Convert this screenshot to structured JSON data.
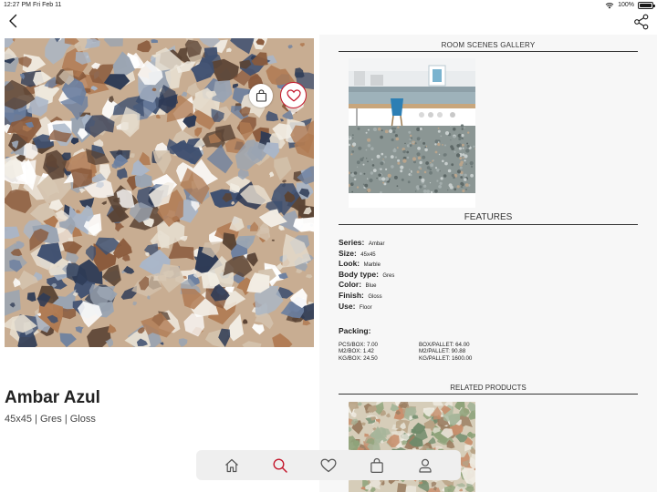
{
  "status_bar": {
    "time": "12:27 PM",
    "date": "Fri Feb 11",
    "battery_text": "100%",
    "battery_level": 1.0
  },
  "nav": {
    "back_icon": "chevron-left-icon",
    "share_icon": "share-icon"
  },
  "product": {
    "title": "Ambar Azul",
    "subtitle": "45x45 | Gres | Gloss",
    "bag_icon": "shopping-bag-icon",
    "heart_icon": "heart-icon",
    "accent_color": "#c4172c"
  },
  "room_scenes": {
    "heading": "ROOM SCENES GALLERY"
  },
  "features": {
    "heading": "FEATURES",
    "items": [
      {
        "label": "Series:",
        "value": "Ambar"
      },
      {
        "label": "Size:",
        "value": "45x45"
      },
      {
        "label": "Look:",
        "value": "Marble"
      },
      {
        "label": "Body type:",
        "value": "Gres"
      },
      {
        "label": "Color:",
        "value": "Blue"
      },
      {
        "label": "Finish:",
        "value": "Gloss"
      },
      {
        "label": "Use:",
        "value": "Floor"
      }
    ]
  },
  "packing": {
    "title": "Packing:",
    "left": [
      "PCS/BOX: 7.00",
      "M2/BOX: 1.42",
      "KG/BOX: 24.50"
    ],
    "right": [
      "BOX/PALLET: 64.00",
      "M2/PALLET: 90.88",
      "KG/PALLET: 1600.00"
    ]
  },
  "related": {
    "heading": "RELATED PRODUCTS"
  },
  "tab_bar": {
    "items": [
      {
        "icon": "home-icon",
        "active": false
      },
      {
        "icon": "search-icon",
        "active": true
      },
      {
        "icon": "heart-icon",
        "active": false
      },
      {
        "icon": "shopping-bag-icon",
        "active": false
      },
      {
        "icon": "user-icon",
        "active": false
      }
    ],
    "active_color": "#c4172c",
    "inactive_color": "#555555"
  }
}
